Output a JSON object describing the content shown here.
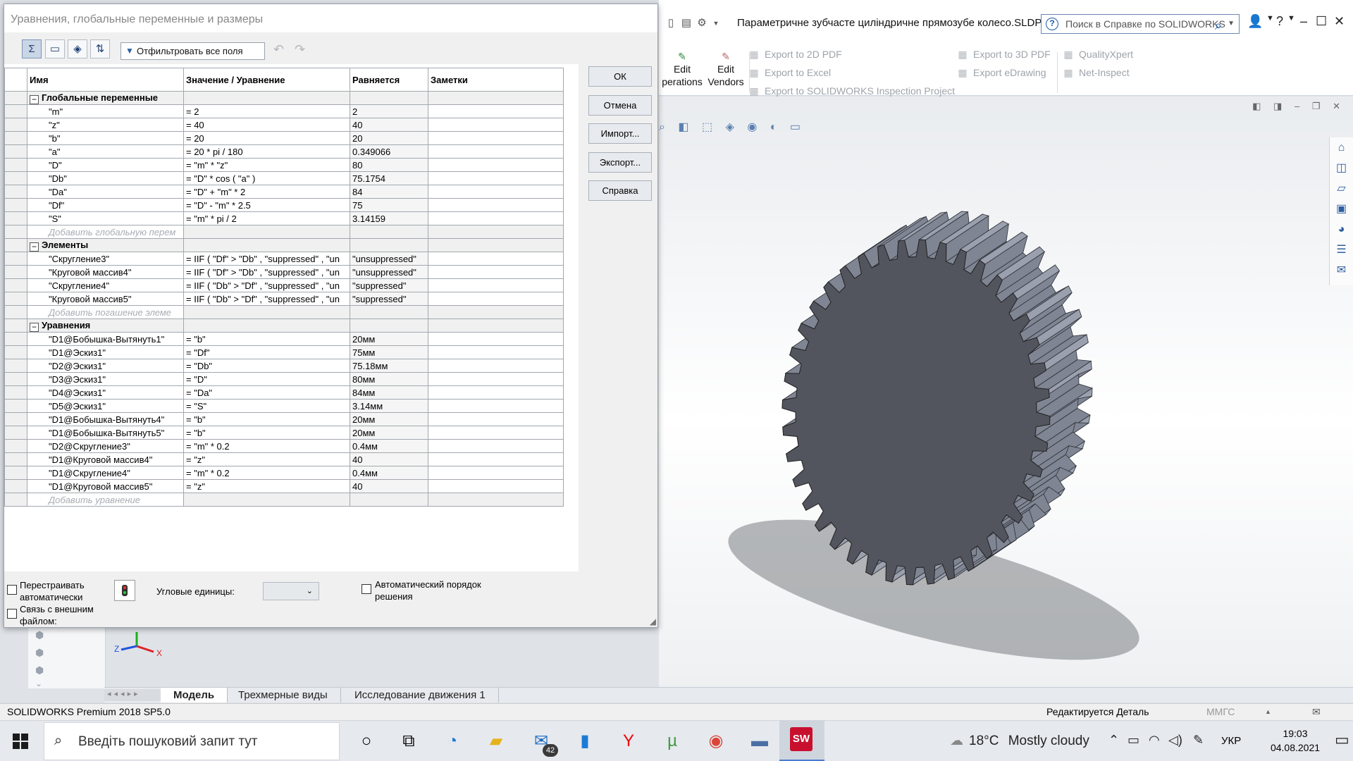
{
  "app": {
    "document_title": "Параметричне зубчасте циліндричне прямозубе колесо.SLDPRT",
    "help_search_placeholder": "Поиск в Справке по SOLIDWORKS",
    "status_left": "SOLIDWORKS Premium 2018 SP5.0",
    "status_mid": "Редактируется Деталь",
    "status_units": "ММГС"
  },
  "ribbon": {
    "big_buttons": [
      {
        "label_line1": "Edit",
        "label_line2": "perations",
        "icon": "edit-operations-icon"
      },
      {
        "label_line1": "Edit",
        "label_line2": "Vendors",
        "icon": "edit-vendors-icon"
      }
    ],
    "small_buttons": [
      {
        "label": "Export to 2D PDF",
        "icon": "pdf-icon"
      },
      {
        "label": "Export to Excel",
        "icon": "excel-icon"
      },
      {
        "label": "Export to SOLIDWORKS Inspection Project",
        "icon": "inspection-icon"
      },
      {
        "label": "Export to 3D PDF",
        "icon": "pdf3d-icon"
      },
      {
        "label": "Export eDrawing",
        "icon": "edrawing-icon"
      },
      {
        "label": "QualityXpert",
        "icon": "quality-icon"
      },
      {
        "label": "Net-Inspect",
        "icon": "net-inspect-icon"
      }
    ]
  },
  "model_tabs": [
    "Модель",
    "Трехмерные виды",
    "Исследование движения 1"
  ],
  "dialog": {
    "title": "Уравнения, глобальные переменные и размеры",
    "filter_text": "Отфильтровать все поля",
    "columns": [
      "Имя",
      "Значение / Уравнение",
      "Равняется",
      "Заметки"
    ],
    "sections": [
      {
        "title": "Глобальные переменные",
        "rows": [
          {
            "name": "\"m\"",
            "eq": "= 2",
            "val": "2"
          },
          {
            "name": "\"z\"",
            "eq": "= 40",
            "val": "40"
          },
          {
            "name": "\"b\"",
            "eq": "= 20",
            "val": "20"
          },
          {
            "name": "\"a\"",
            "eq": "= 20 * pi / 180",
            "val": "0.349066"
          },
          {
            "name": "\"D\"",
            "eq": "= \"m\" * \"z\"",
            "val": "80"
          },
          {
            "name": "\"Db\"",
            "eq": "= \"D\" * cos ( \"a\" )",
            "val": "75.1754"
          },
          {
            "name": "\"Da\"",
            "eq": "= \"D\" + \"m\" * 2",
            "val": "84"
          },
          {
            "name": "\"Df\"",
            "eq": "= \"D\" - \"m\" * 2.5",
            "val": "75"
          },
          {
            "name": "\"S\"",
            "eq": "= \"m\" * pi / 2",
            "val": "3.14159"
          }
        ],
        "add_label": "Добавить глобальную перем"
      },
      {
        "title": "Элементы",
        "rows": [
          {
            "name": "\"Скругление3\"",
            "eq": "= IIF ( \"Df\" > \"Db\" , \"suppressed\" , \"un",
            "val": "\"unsuppressed\""
          },
          {
            "name": "\"Круговой массив4\"",
            "eq": "= IIF ( \"Df\" > \"Db\" , \"suppressed\" , \"un",
            "val": "\"unsuppressed\""
          },
          {
            "name": "\"Скругление4\"",
            "eq": "= IIF ( \"Db\" > \"Df\" , \"suppressed\" , \"un",
            "val": "\"suppressed\""
          },
          {
            "name": "\"Круговой массив5\"",
            "eq": "= IIF ( \"Db\" > \"Df\" , \"suppressed\" , \"un",
            "val": "\"suppressed\""
          }
        ],
        "add_label": "Добавить погашение элеме"
      },
      {
        "title": "Уравнения",
        "rows": [
          {
            "name": "\"D1@Бобышка-Вытянуть1\"",
            "eq": "= \"b\"",
            "val": "20мм"
          },
          {
            "name": "\"D1@Эскиз1\"",
            "eq": "= \"Df\"",
            "val": "75мм"
          },
          {
            "name": "\"D2@Эскиз1\"",
            "eq": "= \"Db\"",
            "val": "75.18мм"
          },
          {
            "name": "\"D3@Эскиз1\"",
            "eq": "= \"D\"",
            "val": "80мм"
          },
          {
            "name": "\"D4@Эскиз1\"",
            "eq": "= \"Da\"",
            "val": "84мм"
          },
          {
            "name": "\"D5@Эскиз1\"",
            "eq": "= \"S\"",
            "val": "3.14мм"
          },
          {
            "name": "\"D1@Бобышка-Вытянуть4\"",
            "eq": "= \"b\"",
            "val": "20мм"
          },
          {
            "name": "\"D1@Бобышка-Вытянуть5\"",
            "eq": "= \"b\"",
            "val": "20мм"
          },
          {
            "name": "\"D2@Скругление3\"",
            "eq": "= \"m\" * 0.2",
            "val": "0.4мм"
          },
          {
            "name": "\"D1@Круговой массив4\"",
            "eq": "= \"z\"",
            "val": "40"
          },
          {
            "name": "\"D1@Скругление4\"",
            "eq": "= \"m\" * 0.2",
            "val": "0.4мм"
          },
          {
            "name": "\"D1@Круговой массив5\"",
            "eq": "= \"z\"",
            "val": "40"
          }
        ],
        "add_label": "Добавить уравнение"
      }
    ],
    "buttons": {
      "ok": "ОК",
      "cancel": "Отмена",
      "import": "Импорт...",
      "export": "Экспорт...",
      "help": "Справка"
    },
    "bottom": {
      "rebuild_line1": "Перестраивать",
      "rebuild_line2": "автоматически",
      "link_line1": "Связь с внешним",
      "link_line2": "файлом:",
      "angular_units": "Угловые единицы:",
      "auto_order_line1": "Автоматический порядок",
      "auto_order_line2": "решения"
    }
  },
  "taskbar": {
    "search_placeholder": "Введіть пошуковий запит тут",
    "mail_badge": "42",
    "sw_logo": "SW",
    "weather_temp": "18°C",
    "weather_text": "Mostly cloudy",
    "lang": "УКР",
    "time": "19:03",
    "date": "04.08.2021"
  },
  "colors": {
    "gear_face": "#52555e",
    "gear_teeth": "#7f8593",
    "accent": "#1a5aa8"
  }
}
